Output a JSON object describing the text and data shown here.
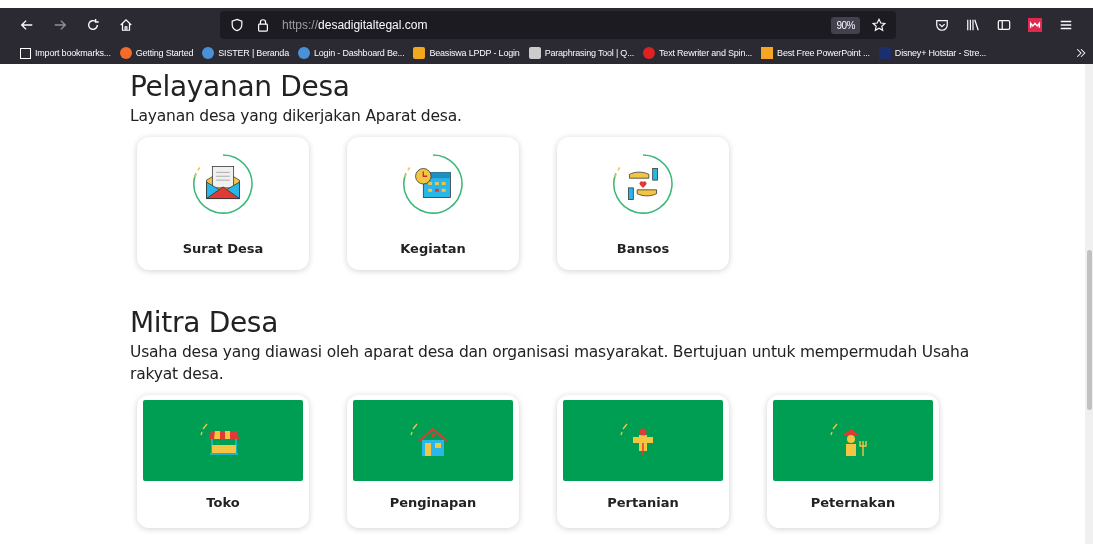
{
  "browser": {
    "url_scheme": "https://",
    "url_host": "desadigitaltegal.com",
    "zoom": "90%",
    "bookmarks": [
      "Import bookmarks...",
      "Getting Started",
      "SISTER | Beranda",
      "Login - Dashboard Be...",
      "Beasiswa LPDP - Login",
      "Paraphrasing Tool | Q...",
      "Text Rewriter and Spin...",
      "Best Free PowerPoint ...",
      "Disney+ Hotstar - Stre..."
    ]
  },
  "sections": [
    {
      "title": "Pelayanan Desa",
      "description": "Layanan desa yang dikerjakan Aparat desa.",
      "kind": "ring",
      "cards": [
        {
          "label": "Surat Desa"
        },
        {
          "label": "Kegiatan"
        },
        {
          "label": "Bansos"
        }
      ]
    },
    {
      "title": "Mitra Desa",
      "description": "Usaha desa yang diawasi oleh aparat desa dan organisasi masyarakat. Bertujuan untuk mempermudah Usaha rakyat desa.",
      "kind": "banner",
      "cards": [
        {
          "label": "Toko"
        },
        {
          "label": "Penginapan"
        },
        {
          "label": "Pertanian"
        },
        {
          "label": "Peternakan"
        }
      ]
    }
  ]
}
